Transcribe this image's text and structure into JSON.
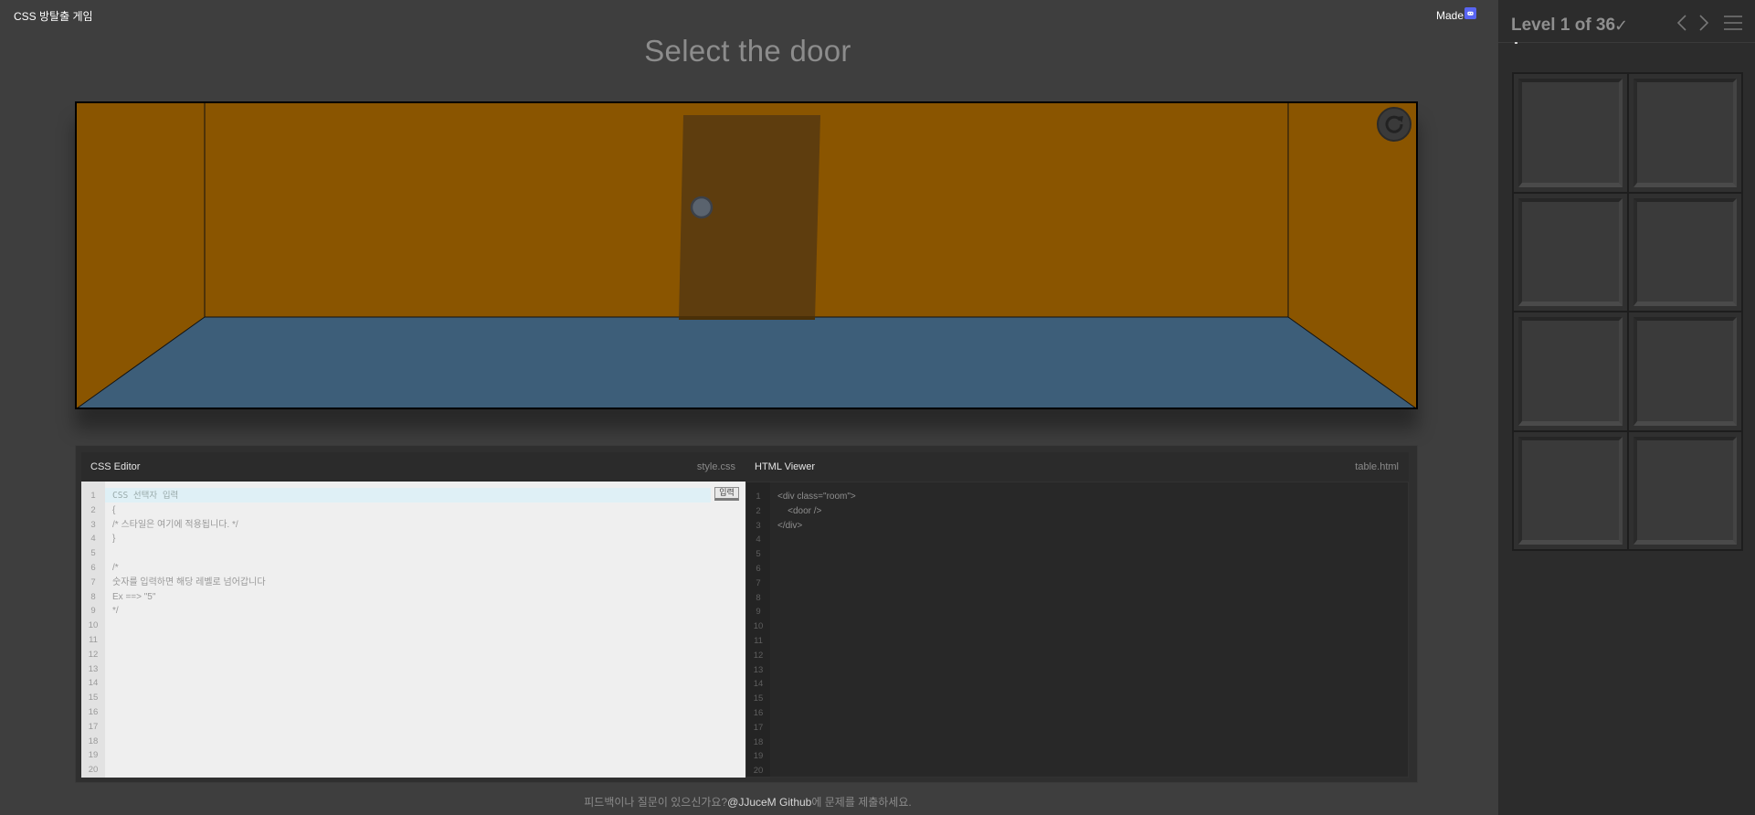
{
  "app_title": "CSS 방탈출 게임",
  "made_label": "Made",
  "made_icon": "discord-icon",
  "heading": "Select the door",
  "room": {
    "wall_color": "#8a5500",
    "floor_color": "#3d5e79",
    "door_color": "#5e3d0e",
    "refresh_icon": "refresh-icon"
  },
  "css_editor": {
    "title": "CSS Editor",
    "file": "style.css",
    "submit_label": "입력",
    "lines": [
      "CSS 선택자 입력",
      "{",
      "/* 스타일은 여기에 적용됩니다. */",
      "}",
      "",
      "/*",
      "숫자를 입력하면 해당 레벨로 넘어갑니다",
      "Ex ==> \"5\"",
      "*/",
      "",
      "",
      "",
      "",
      "",
      "",
      "",
      "",
      "",
      "",
      ""
    ],
    "line_numbers": [
      "1",
      "2",
      "3",
      "4",
      "5",
      "6",
      "7",
      "8",
      "9",
      "10",
      "11",
      "12",
      "13",
      "14",
      "15",
      "16",
      "17",
      "18",
      "19",
      "20"
    ]
  },
  "html_viewer": {
    "title": "HTML Viewer",
    "file": "table.html",
    "lines": [
      "<div class=\"room\">",
      "    <door />",
      "</div>",
      "",
      "",
      "",
      "",
      "",
      "",
      "",
      "",
      "",
      "",
      "",
      "",
      "",
      "",
      "",
      "",
      ""
    ],
    "line_numbers": [
      "1",
      "2",
      "3",
      "4",
      "5",
      "6",
      "7",
      "8",
      "9",
      "10",
      "11",
      "12",
      "13",
      "14",
      "15",
      "16",
      "17",
      "18",
      "19",
      "20"
    ]
  },
  "footer": {
    "prefix": "피드백이나 질문이 있으신가요?",
    "link": "@JJuceM Github",
    "suffix": "에 문제를 제출하세요."
  },
  "sidebar": {
    "level_label": "Level 1 of 36",
    "check_icon": "checkmark-icon",
    "prev_icon": "chevron-left-icon",
    "next_icon": "chevron-right-icon",
    "menu_icon": "hamburger-menu-icon",
    "inventory_slots": 8
  }
}
